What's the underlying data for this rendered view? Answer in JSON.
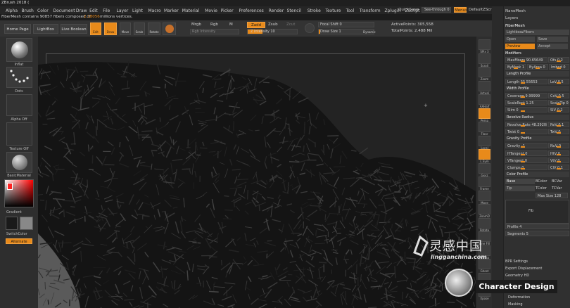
{
  "app": {
    "title": "ZBrush 2018 (",
    "menus": [
      "Alpha",
      "Brush",
      "Color",
      "Document",
      "Draw",
      "Edit",
      "File",
      "Layer",
      "Light",
      "Macro",
      "Marker",
      "Material",
      "Movie",
      "Picker",
      "Preferences",
      "Render",
      "Stencil",
      "Stroke",
      "Texture",
      "Tool",
      "Transform",
      "Zplugin",
      "Zscript"
    ],
    "quicksave": "QuickSave",
    "see_through": "See-through  0",
    "menus_btn": "Menus",
    "default_script": "DefaultZScript"
  },
  "info": {
    "prefix": "FiberMesh contains 90857 fibers composed of",
    "value": "2.18056",
    "suffix": "millions vertices."
  },
  "toolbar": {
    "home_page": "Home Page",
    "lightbox": "LightBox",
    "live_boolean": "Live Boolean",
    "edit": "Edit",
    "draw": "Draw",
    "move": "Move",
    "scale": "Scale",
    "rotate": "Rotate",
    "mrgb": "Mrgb",
    "rgb": "Rgb",
    "m": "M",
    "rgb_intensity": "Rgb Intensity",
    "zadd": "Zadd",
    "zsub": "Zsub",
    "zcut": "Zcut",
    "z_intensity": "Z Intensity 10",
    "focal_shift": "Focal Shift 0",
    "draw_size": "Draw Size 1",
    "dynamic": "Dynamic",
    "active_points": "ActivePoints: 305,558",
    "total_points": "TotalPoints: 2.488 Mil"
  },
  "left_shelf": {
    "inflat": "Inflat",
    "dots": "Dots",
    "alpha_off": "Alpha Off",
    "texture_off": "Texture Off",
    "material": "BasicMaterial",
    "gradient": "Gradient",
    "switch_color": "SwitchColor",
    "alternate": "Alternate"
  },
  "right_shelf": [
    "SPix 3",
    "Scroll",
    "Zoom",
    "Actual",
    "AAHalf",
    "Persp",
    "Floor",
    "Local",
    "L.Sym",
    "Gxyz",
    "Frame",
    "Move",
    "ZoomD",
    "Rotate",
    "Line Fill PolyF",
    "Transp",
    "Ghost",
    "Solo",
    "Xpose"
  ],
  "panel": {
    "nanomesh": "NanoMesh",
    "layers": "Layers",
    "fibermesh": "FiberMesh",
    "lightbox_fibers": "Lightbox▸Fibers",
    "open": "Open",
    "save": "Save",
    "preview": "Preview",
    "accept": "Accept",
    "modifiers": "Modifiers",
    "rows": [
      {
        "a": "MaxFibers 90.65649",
        "b": "Ofs 0.2"
      },
      {
        "a": "ByMask 1",
        "b": "ByArea 0",
        "c": "Imbed 0"
      },
      {
        "head": "Length Profile"
      },
      {
        "a": "Length 55.55653",
        "b": "LeV 0.5"
      },
      {
        "head": "Width Profile"
      },
      {
        "a": "Coverage 9.99999",
        "b": "CoV 0.5"
      },
      {
        "a": "ScaleRoot 1.25",
        "b": "ScaleTip 0.01"
      },
      {
        "a": "Slim 0",
        "b": "SlV 0.2"
      },
      {
        "head": "Revolve Radius"
      },
      {
        "a": "Revolve Rate 48.29208",
        "b": "ReV 0.1"
      },
      {
        "a": "Twist 0",
        "b": "TwV 0"
      },
      {
        "head": "Gravity Profile"
      },
      {
        "a": "Gravity -1",
        "b": "NuV 0"
      },
      {
        "a": "HTangent 0",
        "b": "HtV 0"
      },
      {
        "a": "VTangent 0",
        "b": "VtV 0"
      },
      {
        "a": "Clumps 0",
        "b": "CIV 0.1"
      },
      {
        "head": "Color Profile"
      }
    ],
    "base": "Base",
    "tip": "Tip",
    "bcolor": "BColor",
    "bcvar": "BCVar",
    "tcolor": "TColor",
    "tcvar": "TCVar",
    "max_size": "Max Size 128",
    "fib": "Fib",
    "profile": "Profile 4",
    "segments": "Segments 5",
    "bpr_settings": "BPR Settings",
    "export_displacement": "Export Displacement",
    "geometry_hd": "Geometry HD",
    "deformation": "Deformation",
    "masking": "Masking"
  },
  "watermark": {
    "logo_text": "灵感中国",
    "url": "lingganchina.com",
    "badge": "Character Design"
  },
  "colors": {
    "accent": "#e88a1a",
    "bg": "#2b2b2b"
  }
}
